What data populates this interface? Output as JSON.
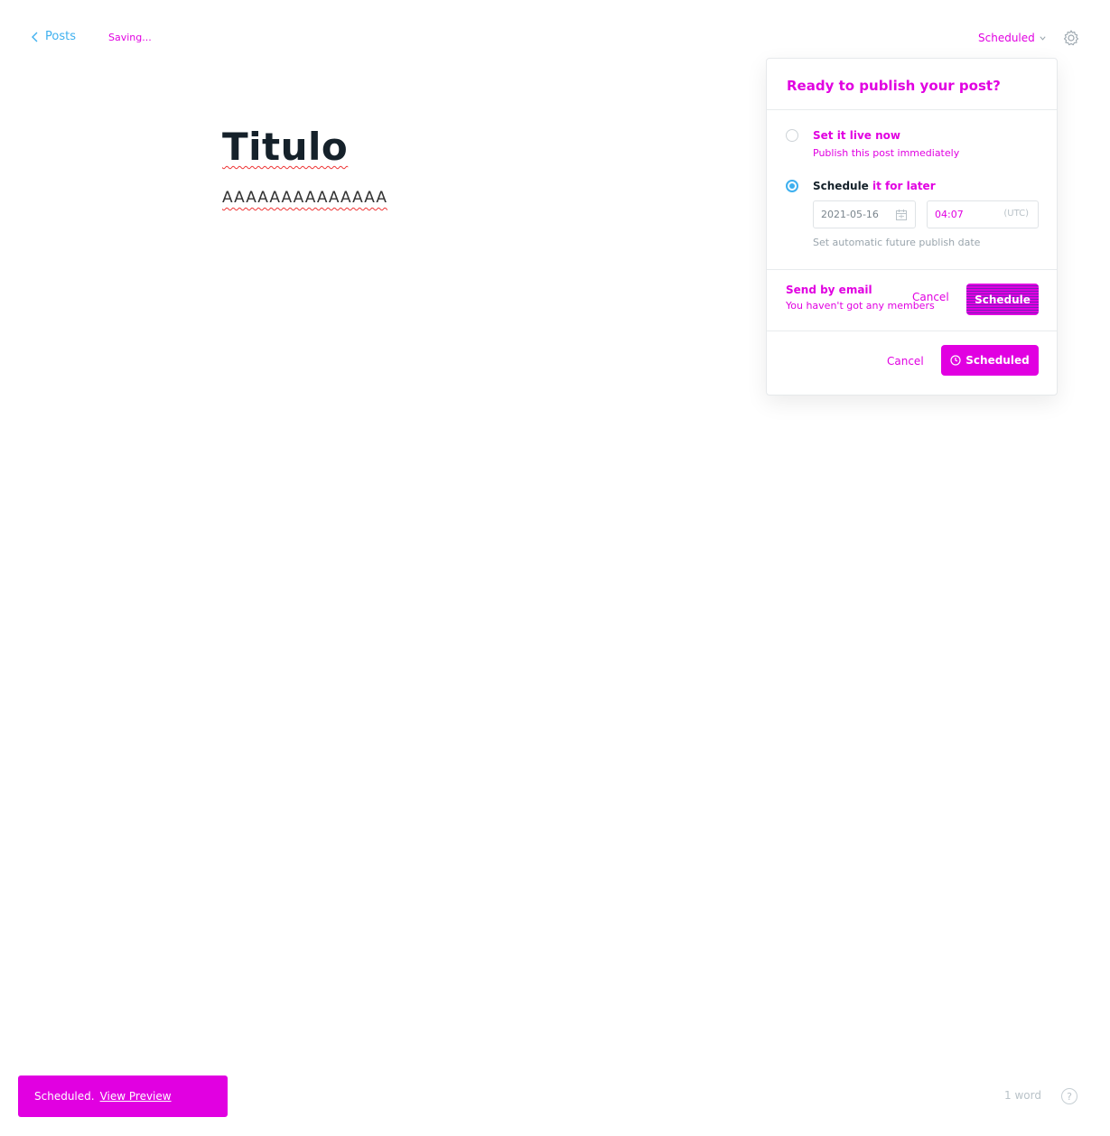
{
  "header": {
    "back_label": "Posts",
    "status_text": "Saving...",
    "post_status_label": "Scheduled",
    "settings_icon": "gear-icon"
  },
  "editor": {
    "title": "Titulo",
    "body": "AAAAAAAAAAAAAA"
  },
  "publish_menu": {
    "heading": "Ready to publish your post?",
    "options": [
      {
        "title": "Set it live now",
        "description": "Publish this post immediately",
        "selected": false
      },
      {
        "title_prefix": "Schedule",
        "title_suffix": "it for later",
        "selected": true
      }
    ],
    "date_value": "2021-05-16",
    "time_value": "04:07",
    "timezone": "(UTC)",
    "hint": "Set automatic future publish date",
    "email": {
      "title": "Send by email",
      "description": "You haven't got any members",
      "cancel_label": "Cancel",
      "schedule_label": "Schedule"
    },
    "footer": {
      "cancel_label": "Cancel",
      "schedule_label": "Scheduled"
    }
  },
  "bottom": {
    "banner_text": "Scheduled.",
    "banner_link": "View Preview",
    "word_count": "1 word",
    "help_label": "?"
  },
  "colors": {
    "accent": "#3eb0ef",
    "highlight": "#e100e1",
    "text": "#15212a"
  }
}
